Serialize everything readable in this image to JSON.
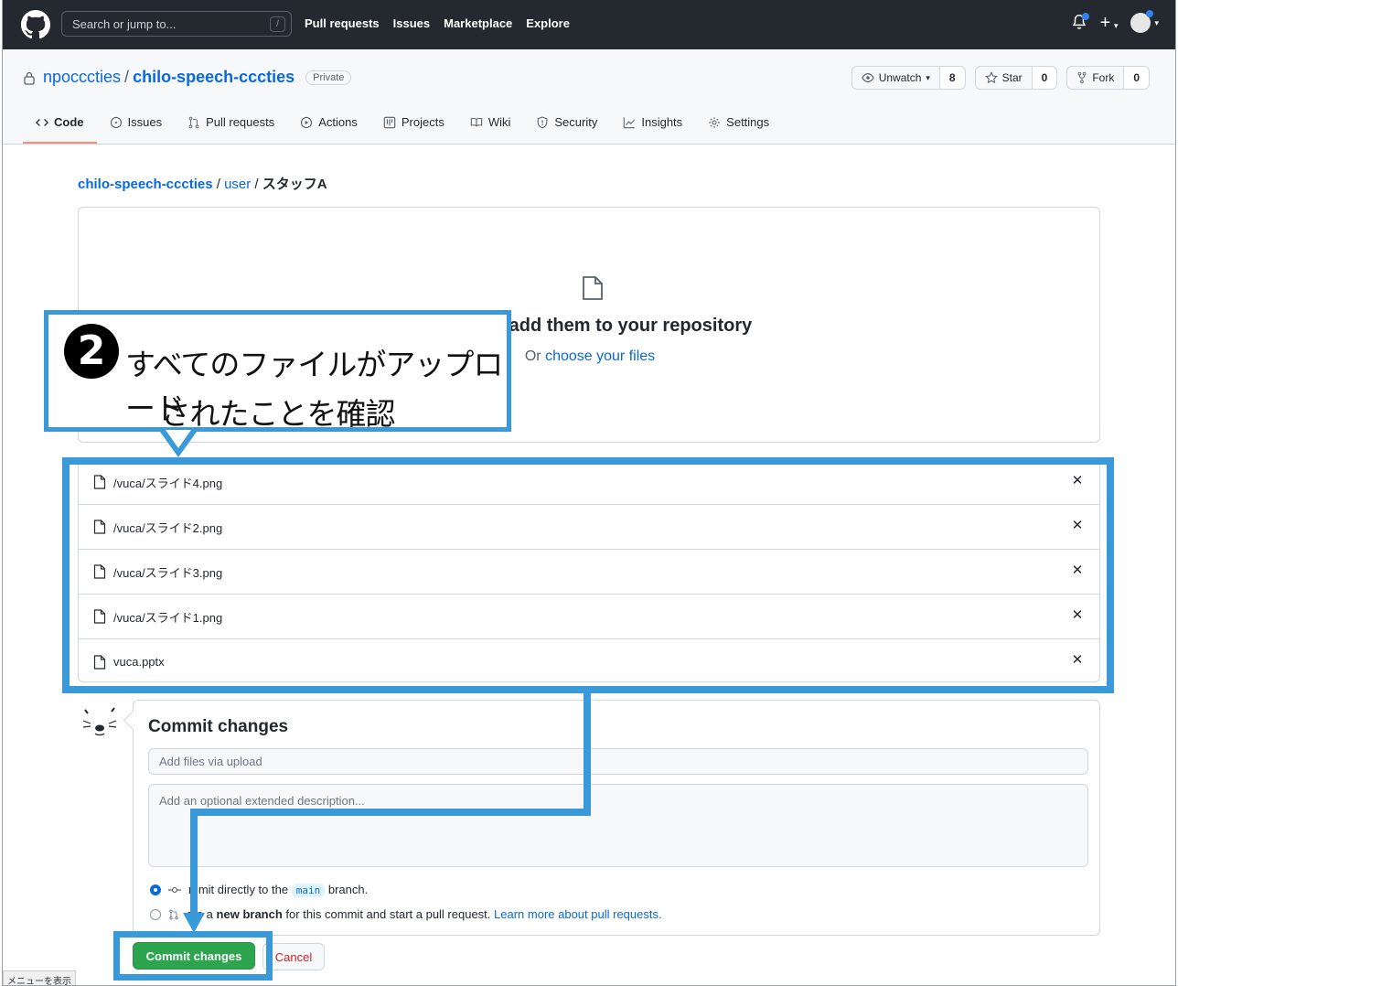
{
  "header": {
    "search_placeholder": "Search or jump to...",
    "search_shortcut": "/",
    "nav": [
      "Pull requests",
      "Issues",
      "Marketplace",
      "Explore"
    ],
    "plus": "+"
  },
  "repo": {
    "owner": "npocccties",
    "sep": "/",
    "name": "chilo-speech-cccties",
    "visibility": "Private",
    "watch_label": "Unwatch",
    "watch_count": "8",
    "star_label": "Star",
    "star_count": "0",
    "fork_label": "Fork",
    "fork_count": "0"
  },
  "tabs": [
    {
      "label": "Code",
      "icon": "code-icon"
    },
    {
      "label": "Issues",
      "icon": "issue-icon"
    },
    {
      "label": "Pull requests",
      "icon": "pull-request-icon"
    },
    {
      "label": "Actions",
      "icon": "play-icon"
    },
    {
      "label": "Projects",
      "icon": "project-icon"
    },
    {
      "label": "Wiki",
      "icon": "book-icon"
    },
    {
      "label": "Security",
      "icon": "shield-icon"
    },
    {
      "label": "Insights",
      "icon": "graph-icon"
    },
    {
      "label": "Settings",
      "icon": "gear-icon"
    }
  ],
  "breadcrumb": {
    "repo": "chilo-speech-cccties",
    "sep1": " / ",
    "folder": "user",
    "sep2": " / ",
    "current": "スタッフA"
  },
  "dropzone": {
    "title": "s here to add them to your repository",
    "sub_prefix": "Or ",
    "sub_link": "choose your files"
  },
  "files": [
    {
      "name": "/vuca/スライド4.png"
    },
    {
      "name": "/vuca/スライド2.png"
    },
    {
      "name": "/vuca/スライド3.png"
    },
    {
      "name": "/vuca/スライド1.png"
    },
    {
      "name": "vuca.pptx"
    }
  ],
  "commit": {
    "title": "Commit changes",
    "summary_placeholder": "Add files via upload",
    "description_placeholder": "Add an optional extended description...",
    "option1_prefix": "mmit directly to the",
    "option1_branch": "main",
    "option1_suffix": "branch.",
    "option2_prefix": "ate a",
    "option2_bold": "new branch",
    "option2_suffix": "for this commit and start a pull request.",
    "option2_link": "Learn more about pull requests.",
    "commit_button": "Commit changes",
    "cancel_button": "Cancel"
  },
  "status_tip": "メニューを表示",
  "annotation": {
    "number": "2",
    "line1": "すべてのファイルがアップロード",
    "line2": "されたことを確認",
    "color": "#3a9ad9"
  }
}
